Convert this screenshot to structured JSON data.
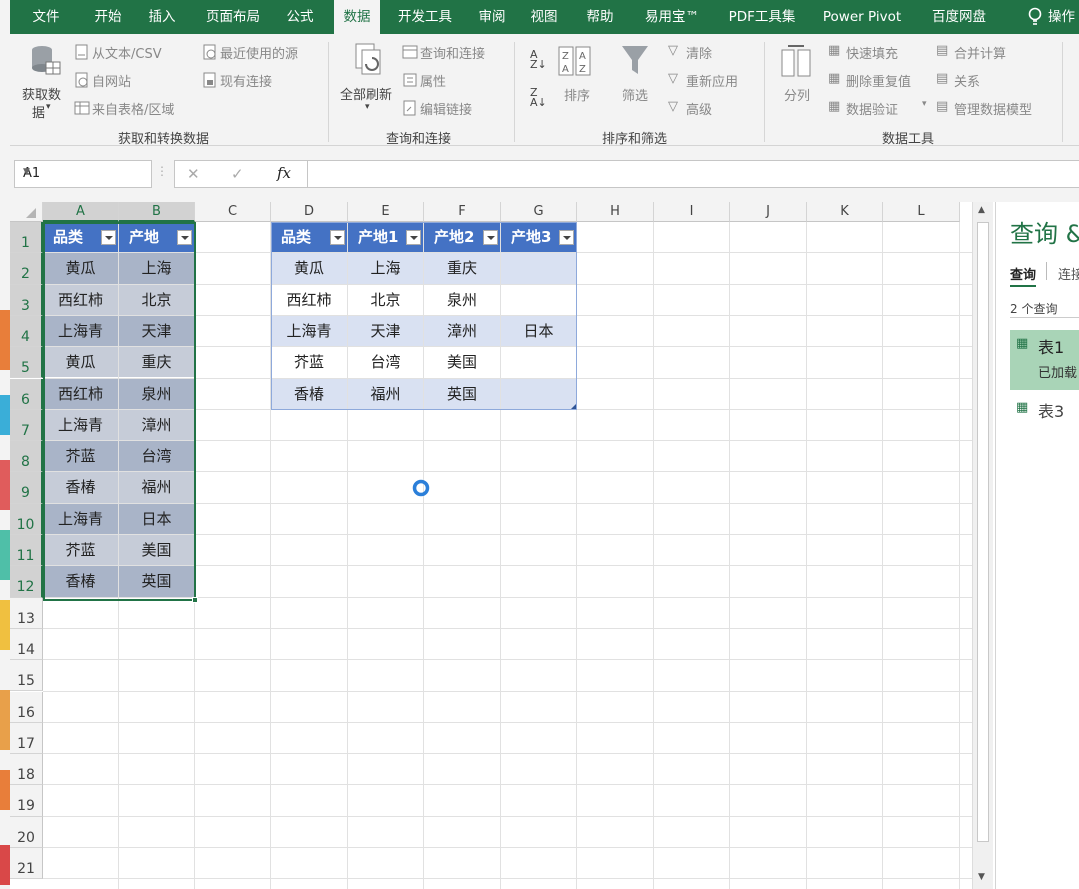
{
  "ribbon_tabs": [
    "文件",
    "开始",
    "插入",
    "页面布局",
    "公式",
    "数据",
    "开发工具",
    "审阅",
    "视图",
    "帮助",
    "易用宝™",
    "PDF工具集",
    "Power Pivot",
    "百度网盘",
    "操作"
  ],
  "ribbon": {
    "get_data": "获取数\n据",
    "get_data_line1": "获取数",
    "get_data_line2": "据",
    "from_text": "从文本/CSV",
    "from_web": "自网站",
    "from_table": "来自表格/区域",
    "recent_sources": "最近使用的源",
    "existing_conn": "现有连接",
    "group1": "获取和转换数据",
    "refresh_all": "全部刷新",
    "queries_conn": "查询和连接",
    "properties": "属性",
    "edit_links": "编辑链接",
    "group2": "查询和连接",
    "sort": "排序",
    "filter": "筛选",
    "clear": "清除",
    "reapply": "重新应用",
    "advanced": "高级",
    "group3": "排序和筛选",
    "text_to_cols": "分列",
    "flash_fill": "快速填充",
    "remove_dup": "删除重复值",
    "data_validation": "数据验证",
    "consolidate": "合并计算",
    "relationships": "关系",
    "data_model": "管理数据模型",
    "group4": "数据工具"
  },
  "formula_bar": {
    "name_box": "A1",
    "fx": "fx",
    "cancel": "✕",
    "enter": "✓"
  },
  "columns": [
    "A",
    "B",
    "C",
    "D",
    "E",
    "F",
    "G",
    "H",
    "I",
    "J",
    "K",
    "L"
  ],
  "rows": [
    "1",
    "2",
    "3",
    "4",
    "5",
    "6",
    "7",
    "8",
    "9",
    "10",
    "11",
    "12",
    "13",
    "14",
    "15",
    "16",
    "17",
    "18",
    "19",
    "20",
    "21"
  ],
  "table1": {
    "headers": [
      "品类",
      "产地"
    ],
    "rows": [
      [
        "黄瓜",
        "上海"
      ],
      [
        "西红柿",
        "北京"
      ],
      [
        "上海青",
        "天津"
      ],
      [
        "黄瓜",
        "重庆"
      ],
      [
        "西红柿",
        "泉州"
      ],
      [
        "上海青",
        "漳州"
      ],
      [
        "芥蓝",
        "台湾"
      ],
      [
        "香椿",
        "福州"
      ],
      [
        "上海青",
        "日本"
      ],
      [
        "芥蓝",
        "美国"
      ],
      [
        "香椿",
        "英国"
      ]
    ]
  },
  "table2": {
    "headers": [
      "品类",
      "产地1",
      "产地2",
      "产地3"
    ],
    "rows": [
      [
        "黄瓜",
        "上海",
        "重庆",
        ""
      ],
      [
        "西红柿",
        "北京",
        "泉州",
        ""
      ],
      [
        "上海青",
        "天津",
        "漳州",
        "日本"
      ],
      [
        "芥蓝",
        "台湾",
        "美国",
        ""
      ],
      [
        "香椿",
        "福州",
        "英国",
        ""
      ]
    ]
  },
  "query_pane": {
    "title": "查询 &",
    "tab_queries": "查询",
    "tab_connections": "连接",
    "count": "2 个查询",
    "items": [
      {
        "name": "表1",
        "status": "已加载"
      },
      {
        "name": "表3",
        "status": ""
      }
    ]
  },
  "colors": {
    "excel_green": "#217346",
    "table_header": "#4472c4",
    "band": "#d9e1f2",
    "selected_fill": "#b4b9c6"
  }
}
